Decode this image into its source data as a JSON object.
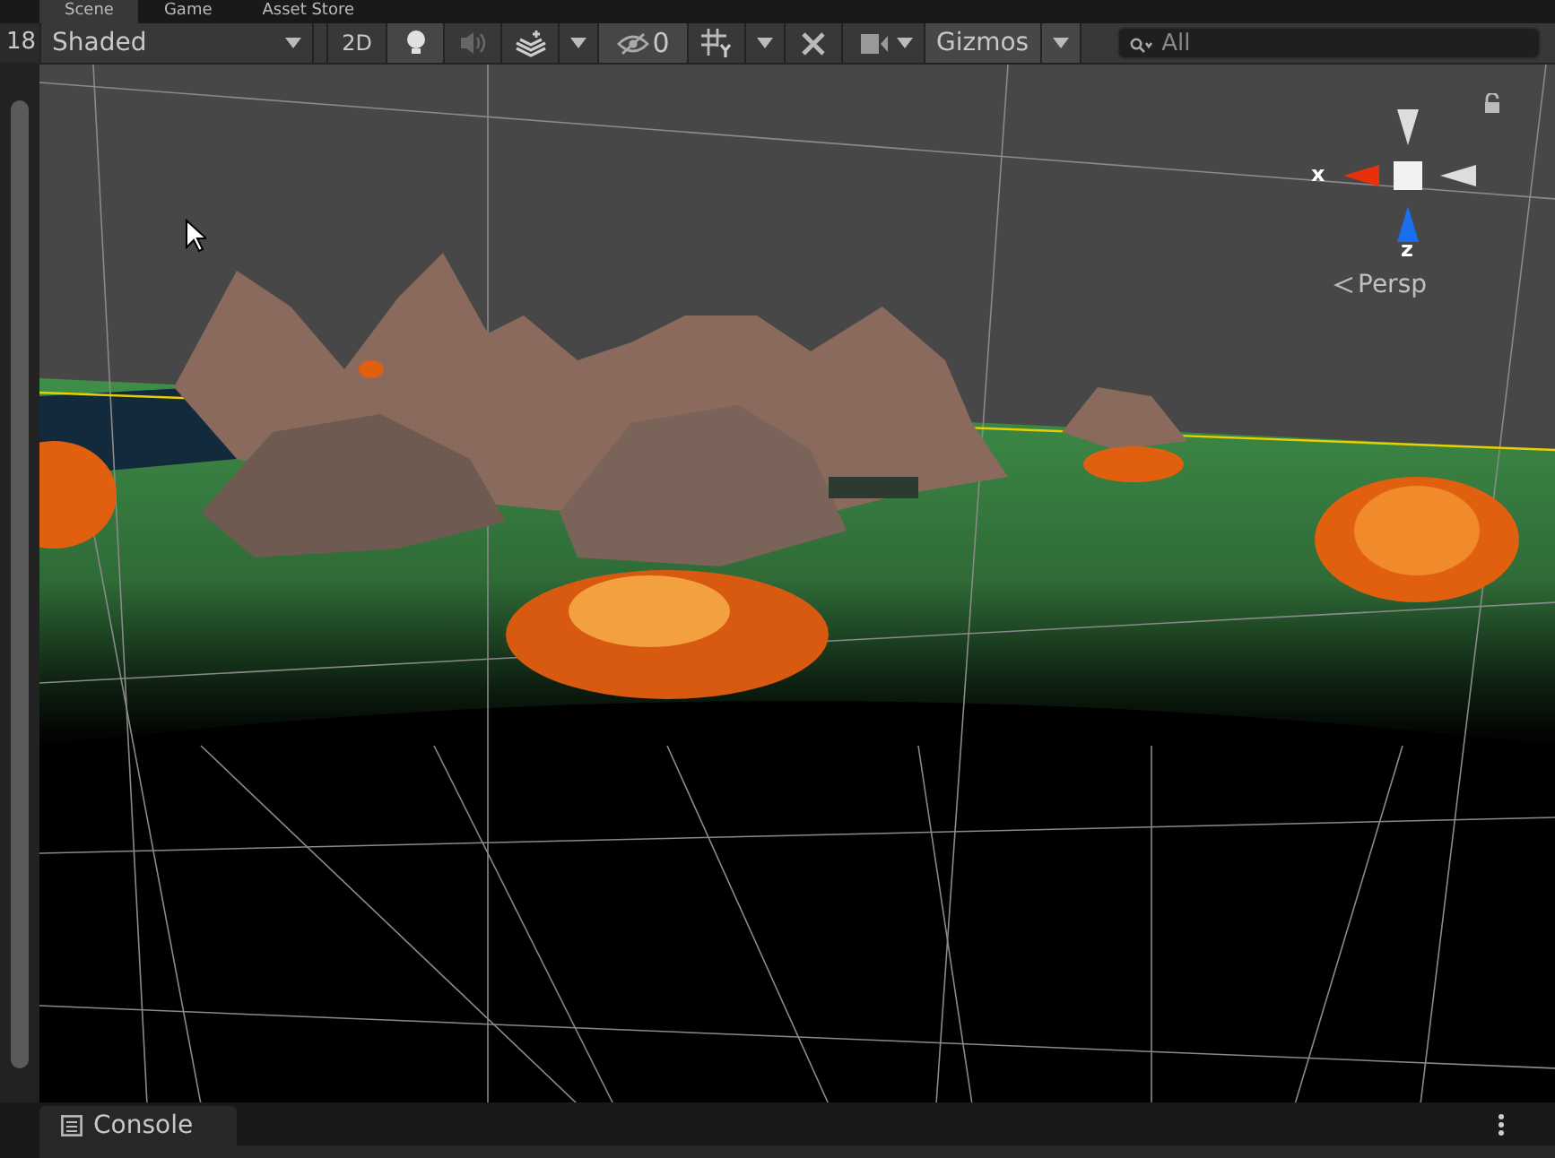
{
  "tabs": [
    {
      "label": "Scene",
      "selected": true
    },
    {
      "label": "Game",
      "selected": false
    },
    {
      "label": "Asset Store",
      "selected": false
    }
  ],
  "toolbar": {
    "side_label": "18",
    "shading_mode": "Shaded",
    "mode_2d": {
      "label": "2D",
      "on": false
    },
    "lighting": {
      "on": true
    },
    "audio": {
      "on": false
    },
    "hidden_count": "0",
    "gizmos": {
      "label": "Gizmos",
      "on": true
    },
    "search": {
      "placeholder": "All"
    }
  },
  "orientation_gizmo": {
    "x_label": "x",
    "z_label": "z",
    "projection": "Persp"
  },
  "console": {
    "label": "Console"
  }
}
